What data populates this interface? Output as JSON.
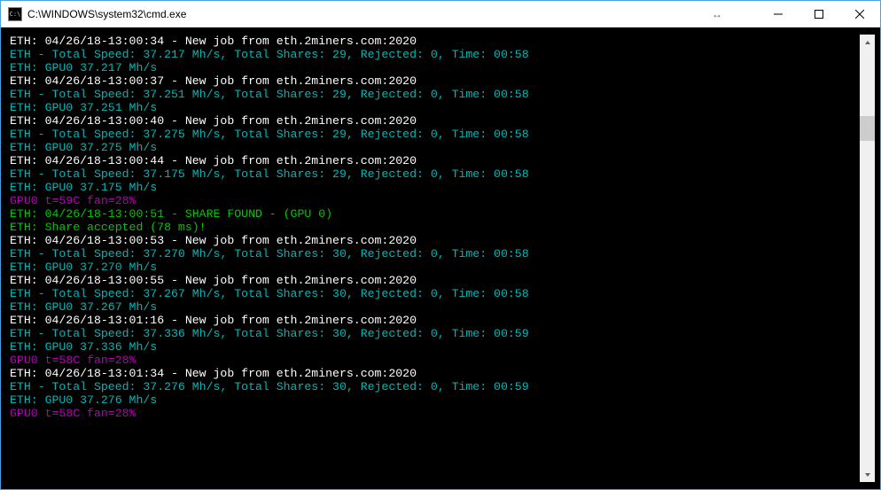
{
  "titlebar": {
    "icon_label": "C:\\",
    "title": "C:\\WINDOWS\\system32\\cmd.exe",
    "resize_glyph": "↔",
    "min_label": "Minimize",
    "max_label": "Maximize",
    "close_label": "Close"
  },
  "scrollbar": {
    "up_label": "Scroll up",
    "down_label": "Scroll down",
    "thumb_label": "Scroll position"
  },
  "colors": {
    "white": "#ffffff",
    "cyan": "#00b7b7",
    "magenta": "#b400b4",
    "green": "#00c800"
  },
  "lines": [
    {
      "text": "ETH: 04/26/18-13:00:34 - New job from eth.2miners.com:2020",
      "class": "c-white"
    },
    {
      "text": "ETH - Total Speed: 37.217 Mh/s, Total Shares: 29, Rejected: 0, Time: 00:58",
      "class": "c-cyan"
    },
    {
      "text": "ETH: GPU0 37.217 Mh/s",
      "class": "c-cyan"
    },
    {
      "text": "ETH: 04/26/18-13:00:37 - New job from eth.2miners.com:2020",
      "class": "c-white"
    },
    {
      "text": "ETH - Total Speed: 37.251 Mh/s, Total Shares: 29, Rejected: 0, Time: 00:58",
      "class": "c-cyan"
    },
    {
      "text": "ETH: GPU0 37.251 Mh/s",
      "class": "c-cyan"
    },
    {
      "text": "ETH: 04/26/18-13:00:40 - New job from eth.2miners.com:2020",
      "class": "c-white"
    },
    {
      "text": "ETH - Total Speed: 37.275 Mh/s, Total Shares: 29, Rejected: 0, Time: 00:58",
      "class": "c-cyan"
    },
    {
      "text": "ETH: GPU0 37.275 Mh/s",
      "class": "c-cyan"
    },
    {
      "text": "ETH: 04/26/18-13:00:44 - New job from eth.2miners.com:2020",
      "class": "c-white"
    },
    {
      "text": "ETH - Total Speed: 37.175 Mh/s, Total Shares: 29, Rejected: 0, Time: 00:58",
      "class": "c-cyan"
    },
    {
      "text": "ETH: GPU0 37.175 Mh/s",
      "class": "c-cyan"
    },
    {
      "text": "GPU0 t=59C fan=28%",
      "class": "c-mag"
    },
    {
      "text": "ETH: 04/26/18-13:00:51 - SHARE FOUND - (GPU 0)",
      "class": "c-green"
    },
    {
      "text": "ETH: Share accepted (78 ms)!",
      "class": "c-green"
    },
    {
      "text": "ETH: 04/26/18-13:00:53 - New job from eth.2miners.com:2020",
      "class": "c-white"
    },
    {
      "text": "ETH - Total Speed: 37.270 Mh/s, Total Shares: 30, Rejected: 0, Time: 00:58",
      "class": "c-cyan"
    },
    {
      "text": "ETH: GPU0 37.270 Mh/s",
      "class": "c-cyan"
    },
    {
      "text": "ETH: 04/26/18-13:00:55 - New job from eth.2miners.com:2020",
      "class": "c-white"
    },
    {
      "text": "ETH - Total Speed: 37.267 Mh/s, Total Shares: 30, Rejected: 0, Time: 00:58",
      "class": "c-cyan"
    },
    {
      "text": "ETH: GPU0 37.267 Mh/s",
      "class": "c-cyan"
    },
    {
      "text": "ETH: 04/26/18-13:01:16 - New job from eth.2miners.com:2020",
      "class": "c-white"
    },
    {
      "text": "ETH - Total Speed: 37.336 Mh/s, Total Shares: 30, Rejected: 0, Time: 00:59",
      "class": "c-cyan"
    },
    {
      "text": "ETH: GPU0 37.336 Mh/s",
      "class": "c-cyan"
    },
    {
      "text": "GPU0 t=58C fan=28%",
      "class": "c-mag"
    },
    {
      "text": "ETH: 04/26/18-13:01:34 - New job from eth.2miners.com:2020",
      "class": "c-white"
    },
    {
      "text": "ETH - Total Speed: 37.276 Mh/s, Total Shares: 30, Rejected: 0, Time: 00:59",
      "class": "c-cyan"
    },
    {
      "text": "ETH: GPU0 37.276 Mh/s",
      "class": "c-cyan"
    },
    {
      "text": "GPU0 t=58C fan=28%",
      "class": "c-mag"
    }
  ]
}
